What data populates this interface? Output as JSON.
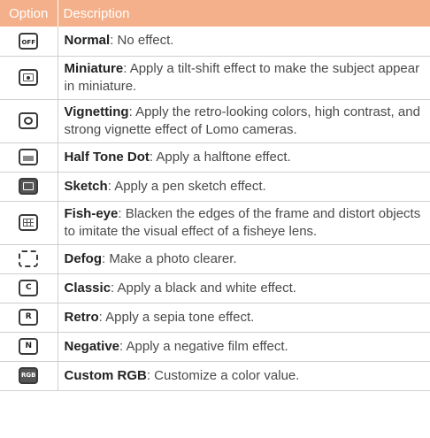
{
  "table": {
    "headers": {
      "option": "Option",
      "description": "Description"
    },
    "rows": [
      {
        "icon": "normal-icon",
        "name": "Normal",
        "text": ": No effect."
      },
      {
        "icon": "miniature-icon",
        "name": "Miniature",
        "text": ": Apply a tilt-shift effect to make the subject appear in miniature."
      },
      {
        "icon": "vignetting-icon",
        "name": "Vignetting",
        "text": ": Apply the retro-looking colors, high contrast, and strong vignette effect of Lomo cameras."
      },
      {
        "icon": "half-tone-dot-icon",
        "name": "Half Tone Dot",
        "text": ": Apply a halftone effect."
      },
      {
        "icon": "sketch-icon",
        "name": "Sketch",
        "text": ": Apply a pen sketch effect."
      },
      {
        "icon": "fish-eye-icon",
        "name": "Fish-eye",
        "text": ": Blacken the edges of the frame and distort objects to imitate the visual effect of a fisheye lens."
      },
      {
        "icon": "defog-icon",
        "name": "Defog",
        "text": ": Make a photo clearer."
      },
      {
        "icon": "classic-icon",
        "name": "Classic",
        "text": ": Apply a black and white effect."
      },
      {
        "icon": "retro-icon",
        "name": "Retro",
        "text": ": Apply a sepia tone effect."
      },
      {
        "icon": "negative-icon",
        "name": "Negative",
        "text": ": Apply a negative film effect."
      },
      {
        "icon": "custom-rgb-icon",
        "name": "Custom RGB",
        "text": ": Customize a color value."
      }
    ]
  },
  "colors": {
    "header_bg": "#f4b08a",
    "header_text": "#ffffff",
    "rule": "#cfcfcf"
  }
}
